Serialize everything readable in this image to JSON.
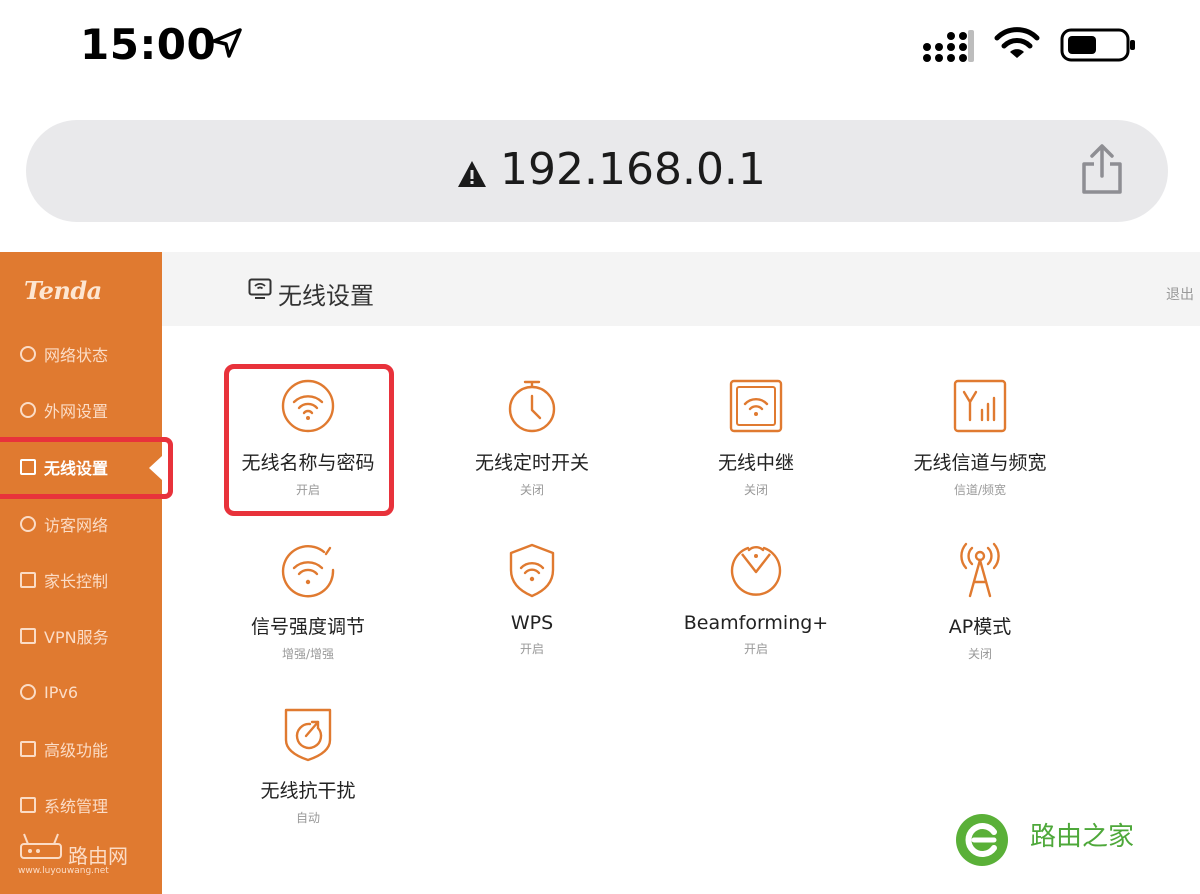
{
  "status_bar": {
    "time": "15:00",
    "icons": [
      "location-arrow-icon",
      "cellular-signal-icon",
      "wifi-icon",
      "battery-icon"
    ]
  },
  "browser": {
    "url": "192.168.0.1",
    "warning_icon": "warning-triangle-icon",
    "share_icon": "share-icon"
  },
  "router": {
    "brand": "Tenda",
    "accent_color": "#e07a30",
    "highlight_color": "#e8323b",
    "sidebar": {
      "items": [
        {
          "label": "网络状态",
          "icon": "globe-icon"
        },
        {
          "label": "外网设置",
          "icon": "internet-settings-icon"
        },
        {
          "label": "无线设置",
          "icon": "wireless-settings-icon",
          "active": true
        },
        {
          "label": "访客网络",
          "icon": "guest-icon"
        },
        {
          "label": "家长控制",
          "icon": "parental-control-icon"
        },
        {
          "label": "VPN服务",
          "icon": "vpn-icon"
        },
        {
          "label": "IPv6",
          "icon": "ipv6-icon"
        },
        {
          "label": "高级功能",
          "icon": "advanced-icon"
        },
        {
          "label": "系统管理",
          "icon": "system-icon"
        }
      ]
    },
    "header": {
      "title": "无线设置",
      "logout": "退出"
    },
    "tiles": [
      {
        "label": "无线名称与密码",
        "status": "开启",
        "icon": "wifi-circle-icon",
        "highlighted": true
      },
      {
        "label": "无线定时开关",
        "status": "关闭",
        "icon": "timer-icon"
      },
      {
        "label": "无线中继",
        "status": "关闭",
        "icon": "wifi-repeater-icon"
      },
      {
        "label": "无线信道与频宽",
        "status": "信道/频宽",
        "icon": "channel-bandwidth-icon"
      },
      {
        "label": "信号强度调节",
        "status": "增强/增强",
        "icon": "signal-strength-icon"
      },
      {
        "label": "WPS",
        "status": "开启",
        "icon": "wps-shield-icon"
      },
      {
        "label": "Beamforming+",
        "status": "开启",
        "icon": "beamforming-icon"
      },
      {
        "label": "AP模式",
        "status": "关闭",
        "icon": "ap-antenna-icon"
      },
      {
        "label": "无线抗干扰",
        "status": "自动",
        "icon": "anti-interference-icon"
      }
    ]
  },
  "watermarks": {
    "left_text": "路由网",
    "left_url": "www.luyouwang.net",
    "right_text": "路由之家"
  }
}
